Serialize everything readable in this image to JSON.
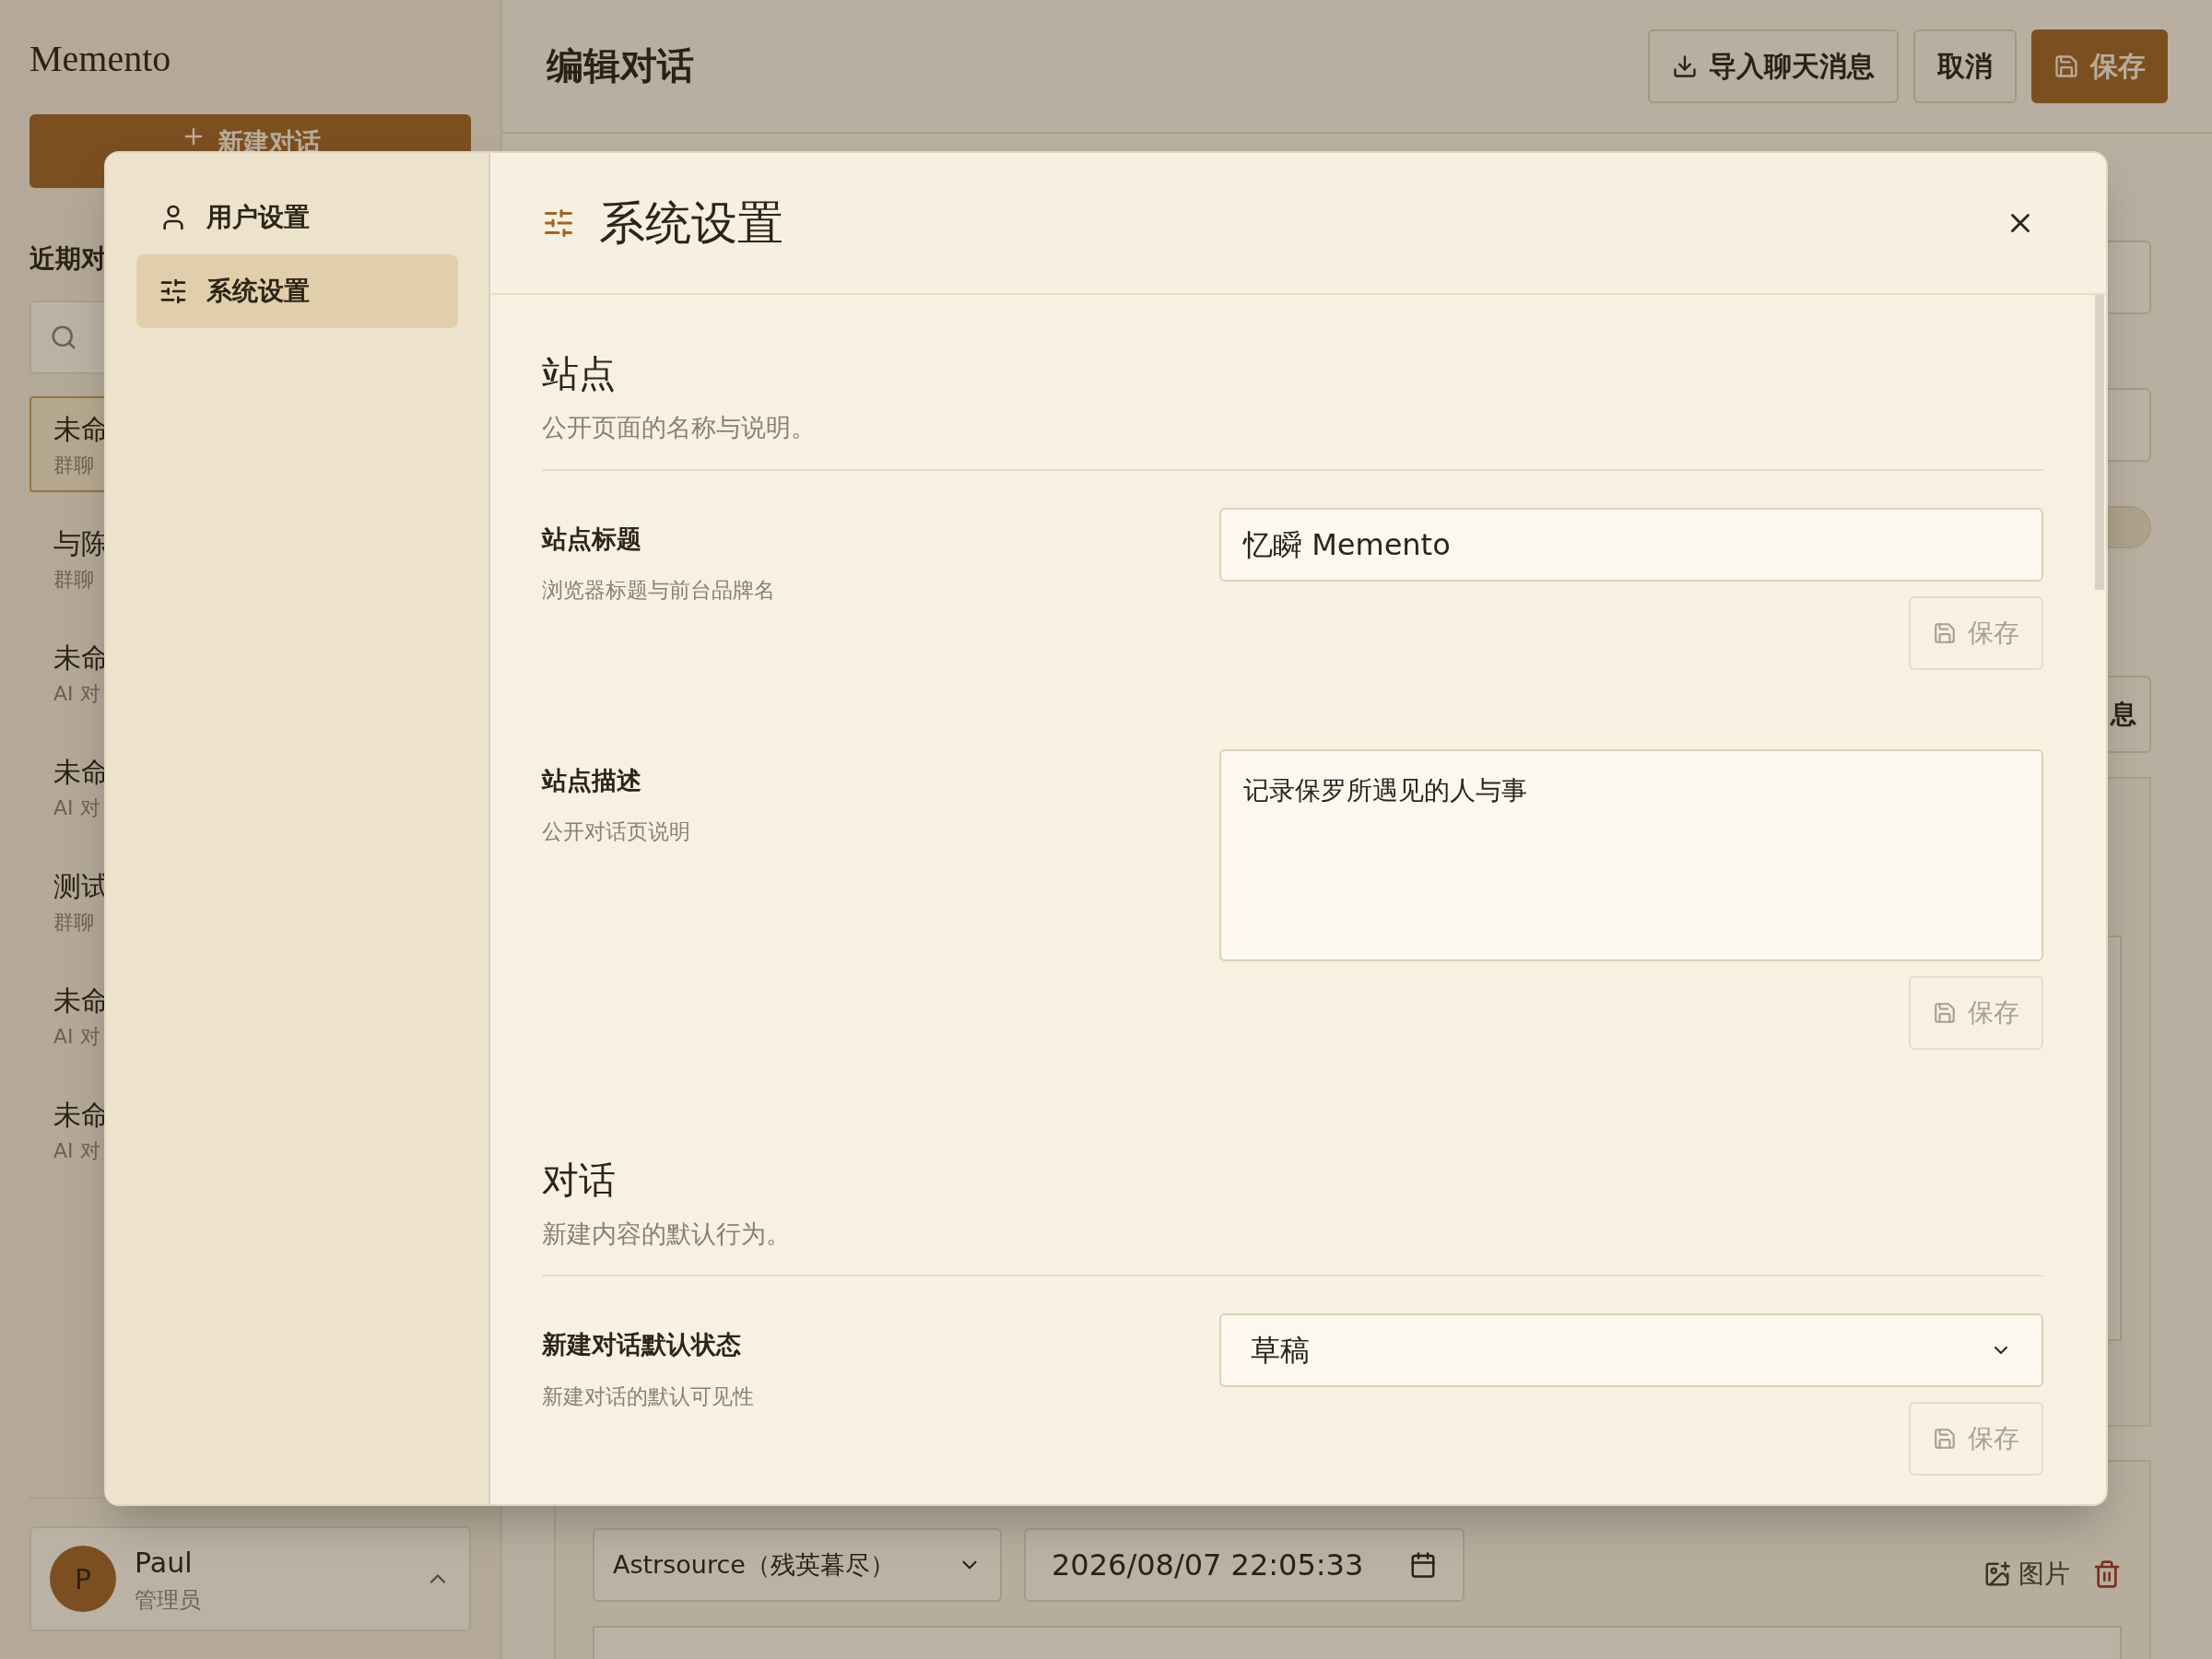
{
  "sidebar": {
    "brand": "Memento",
    "new_button": "新建对话",
    "section_title": "近期对",
    "conversations": [
      {
        "title": "未命",
        "subtitle": "群聊",
        "selected": true
      },
      {
        "title": "与陈",
        "subtitle": "群聊",
        "selected": false
      },
      {
        "title": "未命",
        "subtitle": "AI 对",
        "selected": false
      },
      {
        "title": "未命",
        "subtitle": "AI 对",
        "selected": false
      },
      {
        "title": "测试",
        "subtitle": "群聊",
        "selected": false
      },
      {
        "title": "未命",
        "subtitle": "AI 对",
        "selected": false
      },
      {
        "title": "未命",
        "subtitle": "AI 对",
        "selected": false
      }
    ],
    "user": {
      "avatar": "P",
      "name": "Paul",
      "role": "管理员"
    }
  },
  "header": {
    "title": "编辑对话",
    "buttons": [
      {
        "label": "导入聊天消息",
        "kind": "import"
      },
      {
        "label": "取消",
        "kind": "cancel"
      },
      {
        "label": "保存",
        "kind": "primary"
      }
    ]
  },
  "editor": {
    "side_button": "息",
    "speaker": "Astrsource（残英暮尽）",
    "time": "2026/08/07 22:05:33",
    "image_button": "图片"
  },
  "modal": {
    "nav": [
      {
        "label": "用户设置",
        "selected": false
      },
      {
        "label": "系统设置",
        "selected": true
      }
    ],
    "title": "系统设置",
    "sections": [
      {
        "title": "站点",
        "description": "公开页面的名称与说明。",
        "fields": [
          {
            "kind": "text",
            "label": "站点标题",
            "hint": "浏览器标题与前台品牌名",
            "value": "忆瞬 Memento",
            "save": "保存",
            "disabled": true
          },
          {
            "kind": "textarea",
            "label": "站点描述",
            "hint": "公开对话页说明",
            "value": "记录保罗所遇见的人与事",
            "save": "保存",
            "disabled": true
          }
        ]
      },
      {
        "title": "对话",
        "description": "新建内容的默认行为。",
        "fields": [
          {
            "kind": "select",
            "label": "新建对话默认状态",
            "hint": "新建对话的默认可见性",
            "value": "草稿",
            "save": "保存",
            "disabled": true
          }
        ]
      }
    ]
  }
}
